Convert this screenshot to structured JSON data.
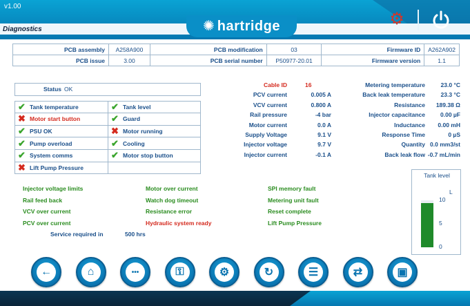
{
  "header": {
    "version": "v1.00",
    "screen_title": "Diagnostics",
    "logo_text": "hartridge"
  },
  "info": {
    "pcb_assembly_label": "PCB assembly",
    "pcb_assembly_value": "A258A900",
    "pcb_modification_label": "PCB modification",
    "pcb_modification_value": "03",
    "firmware_id_label": "Firmware ID",
    "firmware_id_value": "A262A902",
    "pcb_issue_label": "PCB issue",
    "pcb_issue_value": "3.00",
    "pcb_serial_label": "PCB serial number",
    "pcb_serial_value": "P50977-20.01",
    "firmware_version_label": "Firmware version",
    "firmware_version_value": "1.1"
  },
  "status": {
    "label": "Status",
    "value": "OK",
    "items": [
      {
        "left": "Tank temperature",
        "left_state": "ok",
        "right": "Tank level",
        "right_state": "ok"
      },
      {
        "left": "Motor start button",
        "left_state": "fail",
        "right": "Guard",
        "right_state": "ok"
      },
      {
        "left": "PSU OK",
        "left_state": "ok",
        "right": "Motor running",
        "right_state": "fail"
      },
      {
        "left": "Pump overload",
        "left_state": "ok",
        "right": "Cooling",
        "right_state": "ok"
      },
      {
        "left": "System comms",
        "left_state": "ok",
        "right": "Motor stop button",
        "right_state": "ok"
      },
      {
        "left": "Lift Pump Pressure",
        "left_state": "fail",
        "right": "",
        "right_state": "none"
      }
    ]
  },
  "measurements_mid": [
    {
      "label": "Cable ID",
      "value": "16",
      "highlight": true
    },
    {
      "label": "PCV current",
      "value": "0.005 A"
    },
    {
      "label": "VCV current",
      "value": "0.800 A"
    },
    {
      "label": "Rail pressure",
      "value": "-4 bar"
    },
    {
      "label": "Motor current",
      "value": "0.0 A"
    },
    {
      "label": "Supply Voltage",
      "value": "9.1 V"
    },
    {
      "label": "Injector voltage",
      "value": "9.7 V"
    },
    {
      "label": "Injector current",
      "value": "-0.1 A"
    }
  ],
  "measurements_right": [
    {
      "label": "Metering temperature",
      "value": "23.0 °C"
    },
    {
      "label": "Back leak temperature",
      "value": "23.3 °C"
    },
    {
      "label": "Resistance",
      "value": "189.38 Ω"
    },
    {
      "label": "Injector capacitance",
      "value": "0.00 µF"
    },
    {
      "label": "Inductance",
      "value": "0.00 mH"
    },
    {
      "label": "Response Time",
      "value": "0 µS"
    },
    {
      "label": "Quantity",
      "value": "0.0 mm3/st"
    },
    {
      "label": "Back leak flow",
      "value": "-0.7 mL/min"
    }
  ],
  "faults": {
    "col1": [
      "Injector voltage limits",
      "Rail feed back",
      "VCV over current",
      "PCV over current"
    ],
    "col2": [
      "Motor over current",
      "Watch dog timeout",
      "Resistance error",
      "Hydraulic system ready"
    ],
    "col3": [
      "SPI memory fault",
      "Metering unit fault",
      "Reset complete",
      "Lift Pump Pressure"
    ],
    "col2_highlight_index": 3,
    "service_label": "Service required in",
    "service_value": "500 hrs"
  },
  "tank": {
    "title": "Tank level",
    "unit": "L",
    "ticks": [
      "10",
      "5",
      "0"
    ],
    "max": 10,
    "level": 9.4,
    "fill_color": "#1f8a2a"
  },
  "toolbar": {
    "buttons": [
      {
        "name": "back-button",
        "icon": "arrow-left-icon",
        "glyph": "←"
      },
      {
        "name": "home-button",
        "icon": "home-icon",
        "glyph": "⌂"
      },
      {
        "name": "more-button",
        "icon": "ellipsis-icon",
        "glyph": "•••"
      },
      {
        "name": "key-button",
        "icon": "key-icon",
        "glyph": "⚿"
      },
      {
        "name": "settings-button",
        "icon": "gears-icon",
        "glyph": "⚙"
      },
      {
        "name": "refresh-button",
        "icon": "refresh-icon",
        "glyph": "↻"
      },
      {
        "name": "document-button",
        "icon": "document-icon",
        "glyph": "☰"
      },
      {
        "name": "sync-button",
        "icon": "sync-icon",
        "glyph": "⇄"
      },
      {
        "name": "save-button",
        "icon": "save-icon",
        "glyph": "▣"
      }
    ]
  },
  "colors": {
    "brand_blue": "#0577b0",
    "ok_green": "#3aa52d",
    "fail_red": "#d42a1e",
    "text_blue": "#1a4f8a"
  }
}
